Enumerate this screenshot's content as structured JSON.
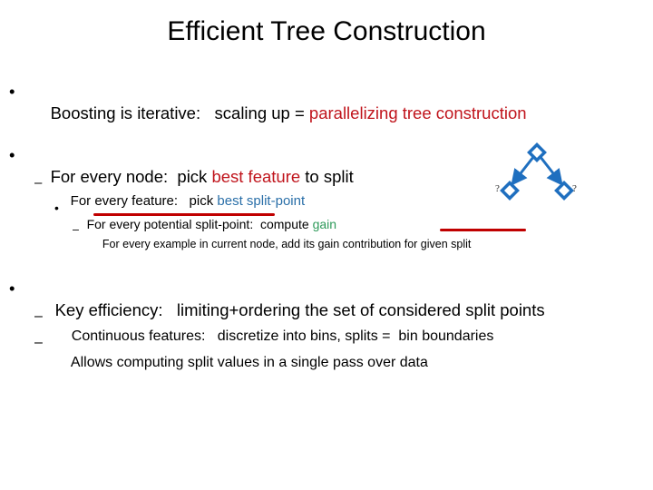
{
  "colors": {
    "text": "#000000",
    "red": "#c0141c",
    "blue": "#2a6fa8",
    "green": "#2e9a5a",
    "annotation_red": "#c00000",
    "diagram_blue": "#1f6fbf"
  },
  "slide": {
    "title": "Efficient Tree Construction",
    "bullets": [
      {
        "marker": "•",
        "segments": [
          {
            "text": "Boosting is iterative:   scaling up = ",
            "color": "text"
          },
          {
            "text": "parallelizing tree construction",
            "color": "red"
          }
        ]
      },
      {
        "marker": "•",
        "segments": [
          {
            "text": "For every node:  pick ",
            "color": "text"
          },
          {
            "text": "best feature",
            "color": "red"
          },
          {
            "text": " to split",
            "color": "text"
          }
        ],
        "children": [
          {
            "marker": "–",
            "segments": [
              {
                "text": "For every feature:   pick ",
                "color": "text"
              },
              {
                "text": "best split-point",
                "color": "blue"
              }
            ],
            "children": [
              {
                "marker": "•",
                "segments": [
                  {
                    "text": "For every potential split-point:  compute ",
                    "color": "text"
                  },
                  {
                    "text": "gain",
                    "color": "green"
                  }
                ],
                "children": [
                  {
                    "marker": "–",
                    "segments": [
                      {
                        "text": "For every example in current node, add its gain contribution ",
                        "color": "text"
                      },
                      {
                        "text": "for given split",
                        "color": "text"
                      }
                    ]
                  }
                ]
              }
            ]
          }
        ]
      },
      {
        "marker": "•",
        "segments": [
          {
            "text": "Key efficiency:   limiting+ordering the set of considered split points",
            "color": "text"
          }
        ],
        "children": [
          {
            "marker": "–",
            "segments": [
              {
                "text": "Continuous features:   discretize into bins, splits =  bin boundaries",
                "color": "text"
              }
            ]
          },
          {
            "marker": "–",
            "segments": [
              {
                "text": "Allows computing split values in a single pass over data",
                "color": "text"
              }
            ]
          }
        ]
      }
    ]
  },
  "diagram": {
    "name": "binary-split-tree",
    "left_label": "?",
    "right_label": "?"
  }
}
